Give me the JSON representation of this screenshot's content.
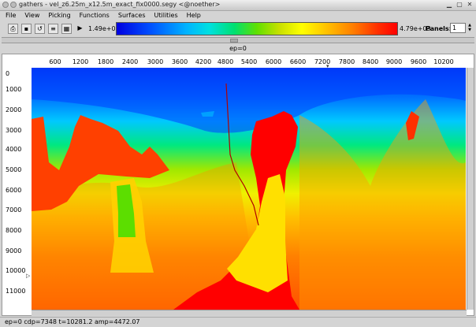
{
  "window": {
    "title": "gathers - vel_z6.25m_x12.5m_exact_fix0000.segy <@noether>",
    "controls": [
      "minimize-icon",
      "maximize-icon",
      "close-icon"
    ]
  },
  "menu": [
    "File",
    "View",
    "Picking",
    "Functions",
    "Surfaces",
    "Utilities",
    "Help"
  ],
  "toolbar": {
    "icons": [
      "print-icon",
      "save-icon",
      "reset-icon",
      "zoom-icon",
      "movie-icon",
      "play-icon"
    ],
    "colorbar_min": "1.49e+03",
    "colorbar_max": "4.79e+03",
    "panels_label": "Panels:",
    "panels_value": "1"
  },
  "plot": {
    "title": "ep=0",
    "x_ticks": [
      "600",
      "1200",
      "1800",
      "2400",
      "3000",
      "3600",
      "4200",
      "4800",
      "5400",
      "6000",
      "6600",
      "7200",
      "7800",
      "8400",
      "9000",
      "9600",
      "10200"
    ],
    "y_ticks": [
      "0",
      "1000",
      "2000",
      "3000",
      "4000",
      "5000",
      "6000",
      "7000",
      "8000",
      "9000",
      "10000",
      "11000"
    ],
    "colors": {
      "low": "#0000e0",
      "mid": "#60e000",
      "high": "#ff0000"
    }
  },
  "status": {
    "text": "ep=0  cdp=7348 t=10281.2 amp=4472.07"
  }
}
